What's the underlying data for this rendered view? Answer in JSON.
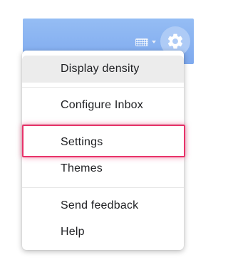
{
  "header": {
    "keyboard_icon": "keyboard-icon",
    "settings_icon": "gear-icon",
    "bar_color": "#8ab4f3"
  },
  "menu": {
    "items": [
      {
        "label": "Display density",
        "state": "hovered"
      },
      {
        "label": "Configure Inbox"
      },
      {
        "label": "Settings",
        "highlighted": true
      },
      {
        "label": "Themes"
      },
      {
        "label": "Send feedback"
      },
      {
        "label": "Help"
      }
    ],
    "highlight_color": "#e8336a"
  }
}
